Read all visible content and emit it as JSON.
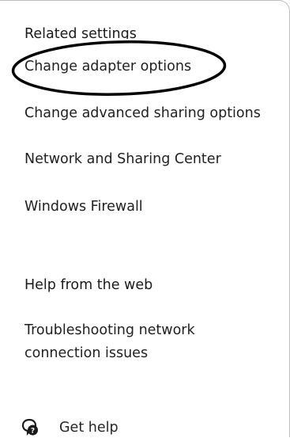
{
  "related_settings": {
    "heading": "Related settings",
    "links": [
      "Change adapter options",
      "Change advanced sharing options",
      "Network and Sharing Center",
      "Windows Firewall"
    ]
  },
  "help": {
    "heading": "Help from the web",
    "links": [
      "Troubleshooting network connection issues"
    ]
  },
  "footer": {
    "get_help_label": "Get help",
    "get_help_icon": "chat-help-icon"
  },
  "colors": {
    "text": "#262626",
    "annotation_stroke": "#000000",
    "border": "#bdbdbd"
  }
}
